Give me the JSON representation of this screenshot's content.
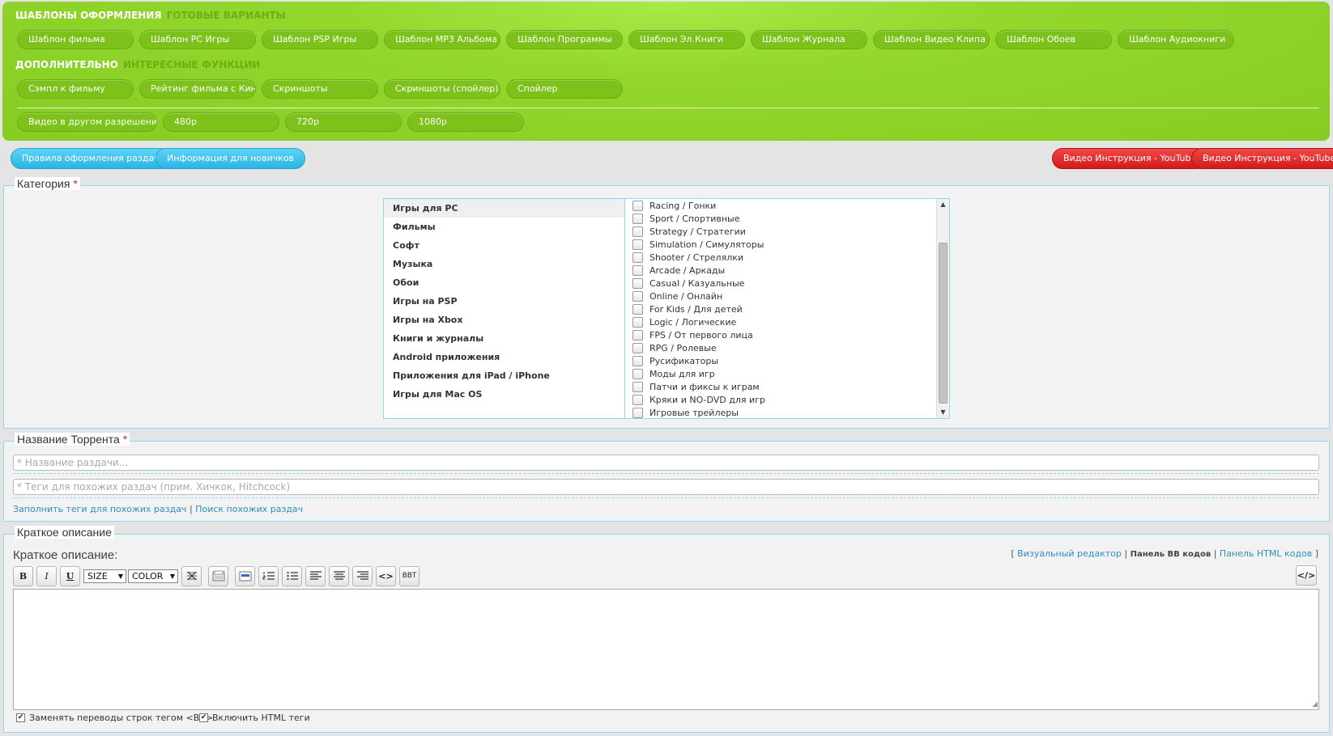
{
  "templates": {
    "title": "ШАБЛОНЫ ОФОРМЛЕНИЯ",
    "subtitle": "ГОТОВЫЕ ВАРИАНТЫ",
    "buttons": [
      "Шаблон фильма",
      "Шаблон PC Игры",
      "Шаблон PSP Игры",
      "Шаблон MP3 Альбома",
      "Шаблон Программы",
      "Шаблон Эл.Книги",
      "Шаблон Журнала",
      "Шаблон Видео Клипа",
      "Шаблон Обоев",
      "Шаблон Аудиокниги"
    ]
  },
  "extras": {
    "title": "ДОПОЛНИТЕЛЬНО",
    "subtitle": "ИНТЕРЕСНЫЕ ФУНКЦИИ",
    "buttons": [
      "Сэмпл к фильму",
      "Рейтинг фильма с Кинопоиск.ру",
      "Скриншоты",
      "Скриншоты (спойлер)",
      "Спойлер"
    ]
  },
  "video": {
    "label": "Видео в другом разрешении:",
    "buttons": [
      "480p",
      "720p",
      "1080p"
    ]
  },
  "info_buttons": {
    "rules": "Правила оформления раздач",
    "newbies": "Информация для новичков",
    "video_1": "Видео Инструкция - YouTube",
    "video_2": "Видео Инструкция - YouTube"
  },
  "category": {
    "legend": "Категория",
    "required_mark": "*",
    "items": [
      "Игры для PC",
      "Фильмы",
      "Софт",
      "Музыка",
      "Обои",
      "Игры на PSP",
      "Игры на Xbox",
      "Книги и журналы",
      "Android приложения",
      "Приложения для iPad / iPhone",
      "Игры для Mac OS"
    ],
    "subitems": [
      "Racing / Гонки",
      "Sport / Спортивные",
      "Strategy / Стратегии",
      "Simulation / Симуляторы",
      "Shooter / Стрелялки",
      "Arcade / Аркады",
      "Casual / Казуальные",
      "Online / Онлайн",
      "For Kids / Для детей",
      "Logic / Логические",
      "FPS / От первого лица",
      "RPG / Ролевые",
      "Русификаторы",
      "Моды для игр",
      "Патчи и фиксы к играм",
      "Кряки и NO-DVD для игр",
      "Игровые трейлеры"
    ]
  },
  "torrent": {
    "legend": "Название Торрента",
    "required_mark": "*",
    "name_placeholder": "* Название раздачи...",
    "tags_placeholder": "* Теги для похожих раздач (прим. Хичкок, Hitchcock)",
    "fill_tags_link": "Заполнить теги для похожих раздач",
    "separator": "|",
    "search_link": "Поиск похожих раздач"
  },
  "description": {
    "legend": "Краткое описание",
    "editor_title": "Краткое описание:",
    "mode_open": "[",
    "mode_visual": "Визуальный редактор",
    "sep1": "|",
    "mode_bb": "Панель BB кодов",
    "sep2": "|",
    "mode_html": "Панель HTML кодов",
    "mode_close": "]",
    "toolbar": {
      "bold": "B",
      "italic": "I",
      "underline": "U",
      "size": "SIZE",
      "color": "COLOR",
      "code": "<>",
      "bbt": "BBT",
      "html_toggle": "</>"
    },
    "replace_br_label": "Заменять переводы строк тегом <BR>",
    "enable_html_label": "Включить HTML теги"
  }
}
